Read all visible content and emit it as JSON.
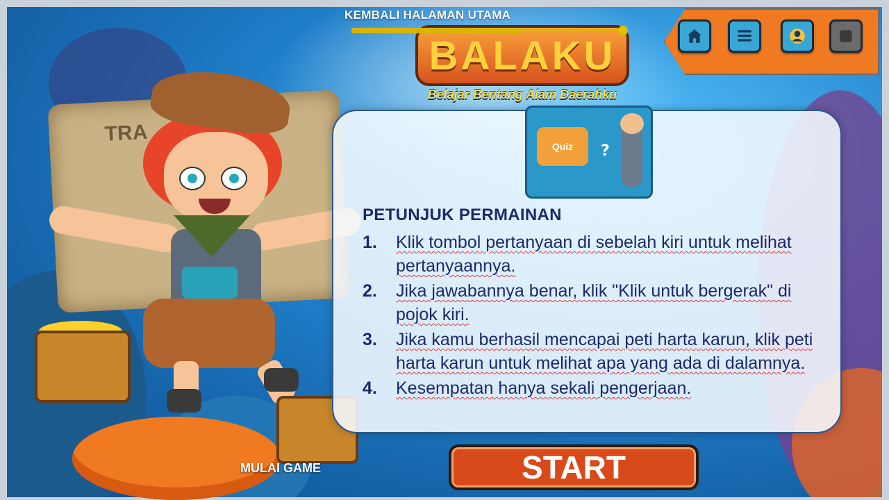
{
  "nav": {
    "back_label": "KEMBALI HALAMAN UTAMA",
    "progress_fraction": 0.62
  },
  "logo": {
    "title": "BALAKU",
    "tagline": "Belajar Bentang Alam Daerahku"
  },
  "menu": {
    "items": [
      {
        "name": "home",
        "icon": "home-icon"
      },
      {
        "name": "list",
        "icon": "list-icon"
      },
      {
        "name": "profile",
        "icon": "profile-icon"
      },
      {
        "name": "exit",
        "icon": "exit-icon"
      }
    ]
  },
  "background": {
    "map_label": "TRA"
  },
  "quiz_card": {
    "label": "Quiz",
    "question_mark": "?"
  },
  "instructions": {
    "title": "PETUNJUK PERMAINAN",
    "steps": [
      {
        "num": "1.",
        "text": "Klik tombol pertanyaan di sebelah kiri untuk melihat pertanyaannya."
      },
      {
        "num": "2.",
        "text": "Jika jawabannya benar, klik \"Klik untuk bergerak\" di pojok kiri."
      },
      {
        "num": "3.",
        "text": "Jika kamu berhasil mencapai peti harta karun, klik peti harta karun untuk melihat apa yang ada di dalamnya."
      },
      {
        "num": "4.",
        "text": "Kesempatan hanya sekali pengerjaan."
      }
    ]
  },
  "buttons": {
    "start": "START",
    "mulai": "MULAI GAME"
  },
  "colors": {
    "menu_bar": "#f07a22",
    "start": "#d94a1a",
    "title_text": "#1a2a6a",
    "slider": "#d9b400"
  }
}
